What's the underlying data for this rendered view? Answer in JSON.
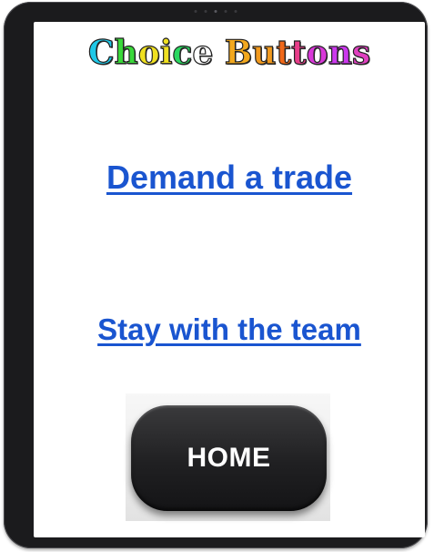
{
  "page": {
    "title_letters": [
      {
        "ch": "C",
        "color": "#1ec8e8"
      },
      {
        "ch": "h",
        "color": "#3ad83a"
      },
      {
        "ch": "o",
        "color": "#f0e020"
      },
      {
        "ch": "i",
        "color": "#f0e020"
      },
      {
        "ch": "c",
        "color": "#2ad860"
      },
      {
        "ch": "e",
        "color": "#ffffff"
      },
      {
        "ch": " ",
        "color": "#ffffff"
      },
      {
        "ch": "B",
        "color": "#f2a81e"
      },
      {
        "ch": "u",
        "color": "#f29a1e"
      },
      {
        "ch": "t",
        "color": "#f06818"
      },
      {
        "ch": "t",
        "color": "#e83e8a"
      },
      {
        "ch": "o",
        "color": "#d838d8"
      },
      {
        "ch": "n",
        "color": "#cc38ee"
      },
      {
        "ch": "s",
        "color": "#e040c0"
      }
    ]
  },
  "choices": {
    "trade_label": "Demand a trade",
    "stay_label": "Stay with the team"
  },
  "home": {
    "label": "HOME"
  },
  "colors": {
    "link": "#1a55d0",
    "frame": "#1b1b1d"
  }
}
